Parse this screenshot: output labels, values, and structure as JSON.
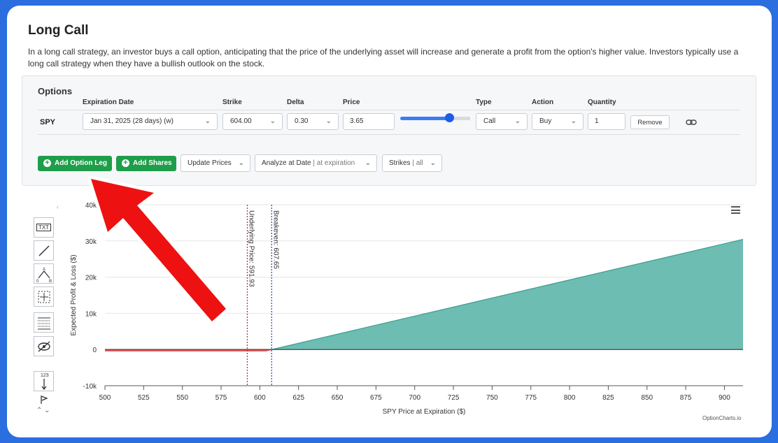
{
  "page": {
    "title": "Long Call",
    "description": "In a long call strategy, an investor buys a call option, anticipating that the price of the underlying asset will increase and generate a profit from the option's higher value. Investors typically use a long call strategy when they have a bullish outlook on the stock."
  },
  "options": {
    "heading": "Options",
    "columns": {
      "expiration": "Expiration Date",
      "strike": "Strike",
      "delta": "Delta",
      "price": "Price",
      "type": "Type",
      "action": "Action",
      "quantity": "Quantity"
    },
    "leg": {
      "symbol": "SPY",
      "expiration": "Jan 31, 2025 (28 days) (w)",
      "strike": "604.00",
      "delta": "0.30",
      "price": "3.65",
      "type": "Call",
      "action": "Buy",
      "quantity": "1",
      "price_slider_fraction": 0.73,
      "remove_label": "Remove"
    },
    "buttons": {
      "add_option_leg": "Add Option Leg",
      "add_shares": "Add Shares",
      "update_prices": "Update Prices",
      "analyze_label": "Analyze at Date",
      "analyze_value": "| at expiration",
      "strikes_label": "Strikes",
      "strikes_value": "| all"
    }
  },
  "chart_data": {
    "type": "area",
    "xlabel": "SPY Price at Expiration ($)",
    "ylabel": "Expected Profit & Loss ($)",
    "xlim": [
      500,
      912
    ],
    "ylim": [
      -10000,
      40000
    ],
    "x_ticks": [
      500,
      525,
      550,
      575,
      600,
      625,
      650,
      675,
      700,
      725,
      750,
      775,
      800,
      825,
      850,
      875,
      900
    ],
    "y_ticks": [
      -10000,
      0,
      10000,
      20000,
      30000,
      40000
    ],
    "y_tick_labels": [
      "-10k",
      "0",
      "10k",
      "20k",
      "30k",
      "40k"
    ],
    "series": [
      {
        "points": [
          [
            500,
            -365
          ],
          [
            604,
            -365
          ],
          [
            607.65,
            0
          ],
          [
            912,
            30435
          ]
        ],
        "profit_color": "#6dbdb3",
        "loss_color": "#e04a4a"
      }
    ],
    "annotations": [
      {
        "label": "Underlying Price: 591.93",
        "x": 591.93,
        "color": "#d42a2a"
      },
      {
        "label": "Breakeven: 607.65",
        "x": 607.65,
        "color": "#2a4fd4"
      }
    ],
    "grid": true,
    "credit": "OptionCharts.io"
  },
  "chart_tools": {
    "text_icon_label": "TXT",
    "angle_a": "A",
    "angle_b": "B",
    "angle_zero": "0",
    "counter_label": "123"
  }
}
